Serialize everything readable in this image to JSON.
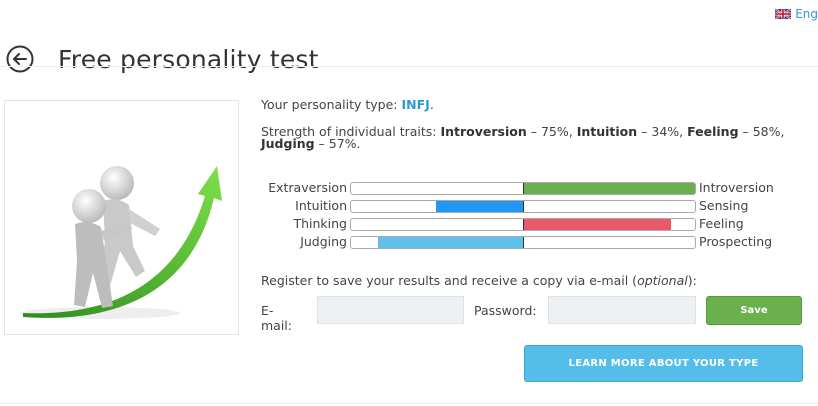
{
  "language": {
    "label": "Eng",
    "flag_icon": "uk-flag-icon"
  },
  "header": {
    "title": "Free personality test",
    "back_icon": "back-arrow-icon"
  },
  "result": {
    "type_prefix": "Your personality type: ",
    "type_value": "INFJ",
    "type_suffix": ".",
    "strength_prefix": "Strength of individual traits: ",
    "strength_items": [
      {
        "name": "Introversion",
        "value": " – 75%, "
      },
      {
        "name": "Intuition",
        "value": " – 34%, "
      },
      {
        "name": "Feeling",
        "value": " – 58%,"
      },
      {
        "name": "Judging",
        "value": " – 57%."
      }
    ]
  },
  "traits": [
    {
      "left": "Extraversion",
      "right": "Introversion",
      "side": "right",
      "percent": 75,
      "color": "#6ab04c"
    },
    {
      "left": "Intuition",
      "right": "Sensing",
      "side": "left",
      "percent": 34,
      "color": "#2196f3"
    },
    {
      "left": "Thinking",
      "right": "Feeling",
      "side": "right",
      "percent": 58,
      "color": "#e8596b"
    },
    {
      "left": "Judging",
      "right": "Prospecting",
      "side": "left",
      "percent": 57,
      "color": "#5fc1ea"
    }
  ],
  "register": {
    "text": "Register to save your results and receive a copy via e-mail (",
    "optional": "optional",
    "text_end": "):",
    "email_label": "E-mail:",
    "email_value": "",
    "password_label": "Password:",
    "password_value": "",
    "save_label": "Save"
  },
  "learn_more_label": "LEARN MORE ABOUT YOUR TYPE",
  "colors": {
    "accent": "#2b9bd6",
    "save": "#6ab04c",
    "learn": "#55bde9"
  }
}
